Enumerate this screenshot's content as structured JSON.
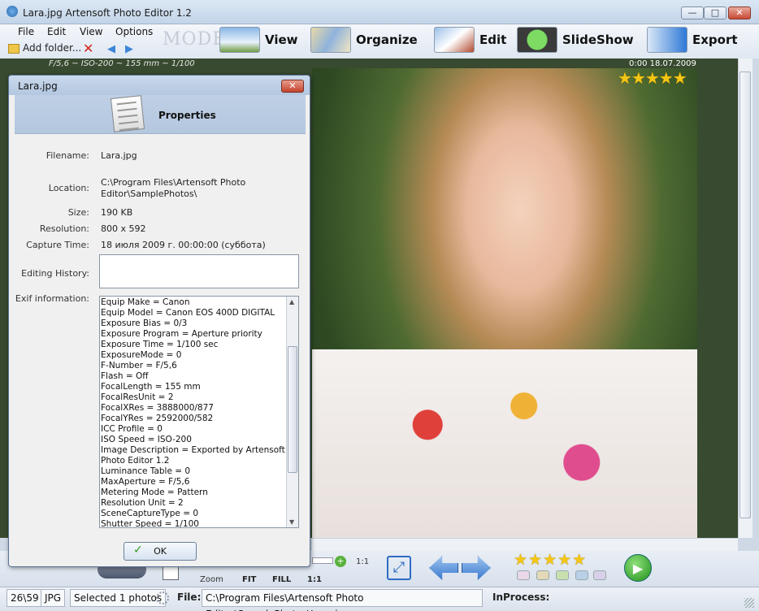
{
  "window": {
    "title": "Lara.jpg    Artensoft Photo Editor 1.2",
    "controls": {
      "minimize": "—",
      "maximize": "□",
      "close": "✕"
    }
  },
  "menu": [
    "File",
    "Edit",
    "View",
    "Options"
  ],
  "toolbar": {
    "add_folder": "Add folder...",
    "delete_icon": "✕",
    "back_icon": "◀",
    "forward_icon": "▶"
  },
  "mode": {
    "label": "MODE:",
    "buttons": [
      {
        "label": "View"
      },
      {
        "label": "Organize"
      },
      {
        "label": "Edit"
      },
      {
        "label": "SlideShow"
      },
      {
        "label": "Export"
      }
    ]
  },
  "photo": {
    "exif_strip": "F/5,6 ~ ISO-200 ~ 155 mm ~ 1/100",
    "datetime": "0:00 18.07.2009",
    "stars": "★★★★★"
  },
  "bottom": {
    "zoom_label": "Zoom",
    "fit_label": "FIT",
    "fill_label": "FILL",
    "one_one_label": "1:1",
    "zoom_scale": "1:1",
    "zoom_plus": "+",
    "rate_stars": "★★★★★",
    "play_icon": "▶"
  },
  "status": {
    "position": "26\\59",
    "format": "JPG",
    "selected": "Selected 1 photos",
    "file_label": "File:",
    "file_path": "C:\\Program Files\\Artensoft Photo Editor\\SamplePhotos\\Lara.jpg",
    "inprocess_label": "InProcess:"
  },
  "dialog": {
    "title": "Lara.jpg",
    "close": "✕",
    "heading": "Properties",
    "filename_label": "Filename:",
    "filename": "Lara.jpg",
    "location_label": "Location:",
    "location_line1": "C:\\Program Files\\Artensoft Photo",
    "location_line2": "Editor\\SamplePhotos\\",
    "size_label": "Size:",
    "size": "190 KB",
    "resolution_label": "Resolution:",
    "resolution": "800 x 592",
    "capture_label": "Capture Time:",
    "capture": "18 июля 2009 г. 00:00:00 (суббота)",
    "history_label": "Editing History:",
    "exif_label": "Exif information:",
    "exif": [
      "Equip Make = Canon",
      "Equip Model = Canon EOS 400D DIGITAL",
      "Exposure Bias = 0/3",
      "Exposure Program = Aperture priority",
      "Exposure Time = 1/100 sec",
      "ExposureMode = 0",
      "F-Number = F/5,6",
      "Flash = Off",
      "FocalLength = 155 mm",
      "FocalResUnit = 2",
      "FocalXRes = 3888000/877",
      "FocalYRes = 2592000/582",
      "ICC Profile = 0",
      "ISO Speed = ISO-200",
      "Image Description = Exported by Artensoft",
      "Photo Editor 1.2",
      "Luminance Table = 0",
      "MaxAperture = F/5,6",
      "Metering Mode = Pattern",
      "Resolution Unit = 2",
      "SceneCaptureType = 0",
      "Shutter Speed = 1/100"
    ],
    "ok": "OK",
    "ok_check": "✓"
  }
}
